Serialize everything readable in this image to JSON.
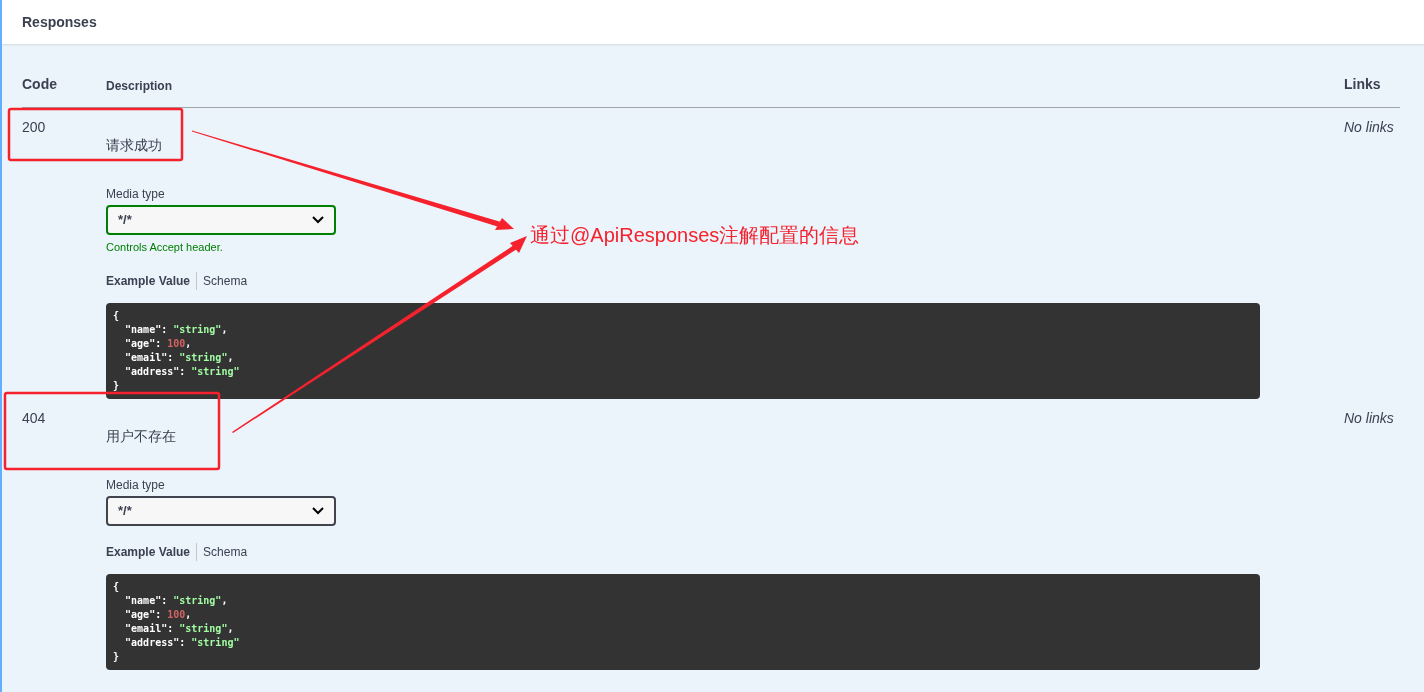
{
  "section": {
    "title": "Responses"
  },
  "table": {
    "columns": [
      "Code",
      "Description",
      "Links"
    ],
    "rows": [
      {
        "code": "200",
        "description": "请求成功",
        "media_type_label": "Media type",
        "media_type": "*/*",
        "accept_controlled": true,
        "hint": "Controls Accept header.",
        "tabs": [
          {
            "label": "Example Value",
            "selected": true
          },
          {
            "label": "Schema",
            "selected": false
          }
        ],
        "example": {
          "open": "{",
          "close": "}",
          "lines": [
            {
              "key": "\"name\": ",
              "value": "\"string\"",
              "kind": "string",
              "trail": ","
            },
            {
              "key": "\"age\": ",
              "value": "100",
              "kind": "number",
              "trail": ","
            },
            {
              "key": "\"email\": ",
              "value": "\"string\"",
              "kind": "string",
              "trail": ","
            },
            {
              "key": "\"address\": ",
              "value": "\"string\"",
              "kind": "string"
            }
          ]
        },
        "links": "No links"
      },
      {
        "code": "404",
        "description": "用户不存在",
        "media_type_label": "Media type",
        "media_type": "*/*",
        "accept_controlled": false,
        "tabs": [
          {
            "label": "Example Value",
            "selected": true
          },
          {
            "label": "Schema",
            "selected": false
          }
        ],
        "example": {
          "open": "{",
          "close": "}",
          "lines": [
            {
              "key": "\"name\": ",
              "value": "\"string\"",
              "kind": "string",
              "trail": ","
            },
            {
              "key": "\"age\": ",
              "value": "100",
              "kind": "number",
              "trail": ","
            },
            {
              "key": "\"email\": ",
              "value": "\"string\"",
              "kind": "string",
              "trail": ","
            },
            {
              "key": "\"address\": ",
              "value": "\"string\"",
              "kind": "string"
            }
          ]
        },
        "links": "No links"
      }
    ]
  },
  "annotation": {
    "text": "通过@ApiResponses注解配置的信息"
  }
}
